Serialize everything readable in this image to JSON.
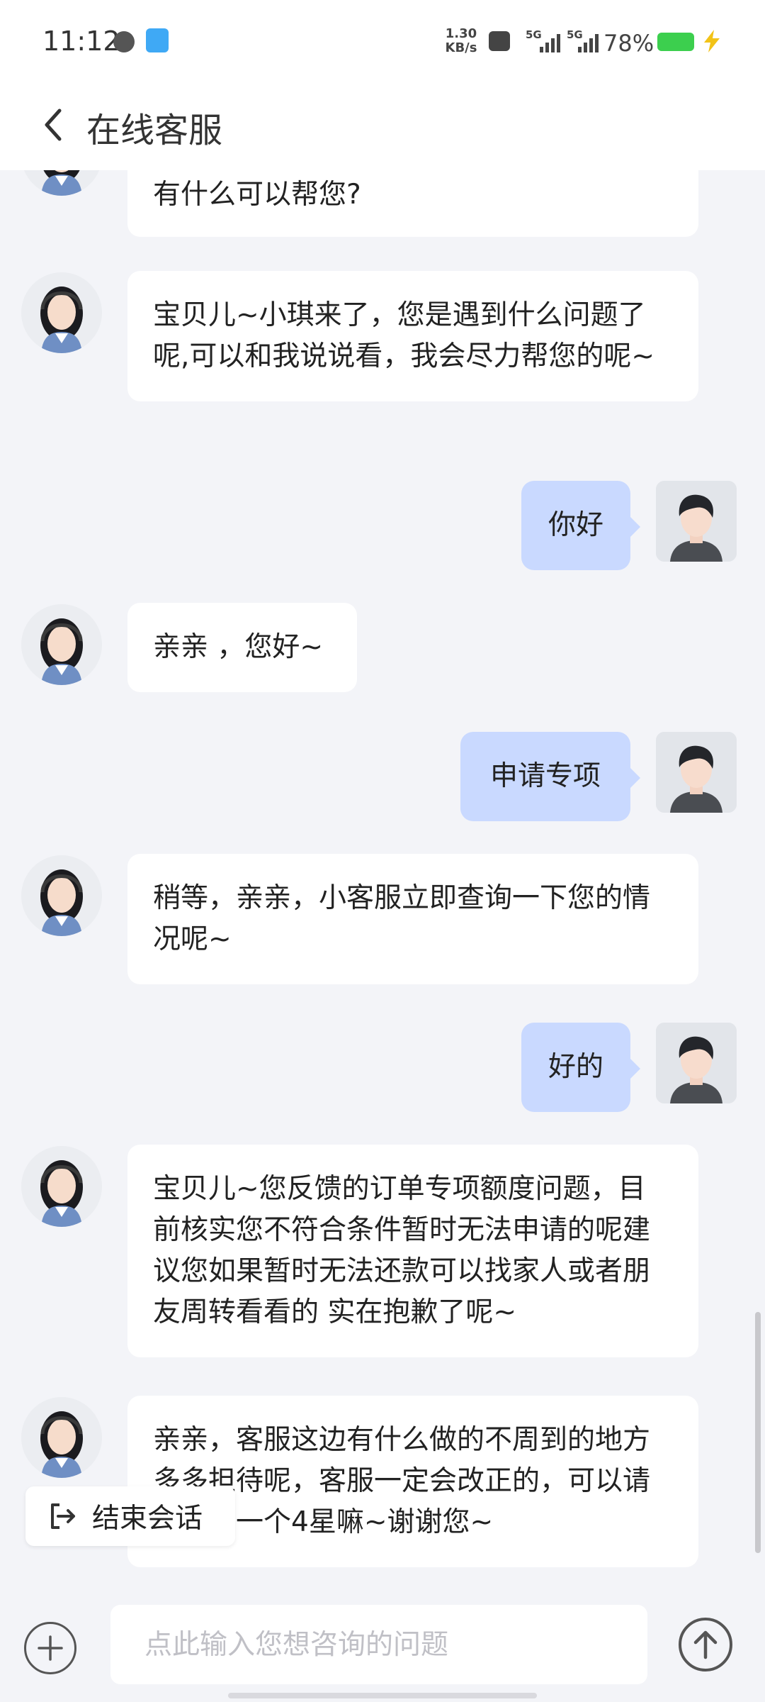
{
  "status_bar": {
    "time": "11:12",
    "net_speed_value": "1.30",
    "net_speed_unit": "KB/s",
    "sim1": "5G",
    "sim2": "5G",
    "battery": "78%"
  },
  "header": {
    "title": "在线客服"
  },
  "messages": [
    {
      "from": "agent",
      "text": "有什么可以帮您?"
    },
    {
      "from": "agent",
      "text": "宝贝儿~小琪来了，您是遇到什么问题了呢,可以和我说说看，我会尽力帮您的呢~"
    },
    {
      "from": "user",
      "text": "你好"
    },
    {
      "from": "agent",
      "text": "亲亲 ，您好~"
    },
    {
      "from": "user",
      "text": "申请专项"
    },
    {
      "from": "agent",
      "text": "稍等，亲亲，小客服立即查询一下您的情况呢~"
    },
    {
      "from": "user",
      "text": "好的"
    },
    {
      "from": "agent",
      "text": "宝贝儿~您反馈的订单专项额度问题，目前核实您不符合条件暂时无法申请的呢建议您如果暂时无法还款可以找家人或者朋友周转看看的 实在抱歉了呢~"
    },
    {
      "from": "agent",
      "text": "亲亲，客服这边有什么做的不周到的地方多多担待呢，客服一定会改正的，可以请您给咱一个4星嘛~谢谢您~"
    }
  ],
  "end_session": {
    "label": "结束会话"
  },
  "input": {
    "placeholder": "点此输入您想咨询的问题"
  },
  "colors": {
    "user_bubble": "#c9d9ff",
    "agent_bubble": "#ffffff",
    "background": "#f3f4f8"
  }
}
